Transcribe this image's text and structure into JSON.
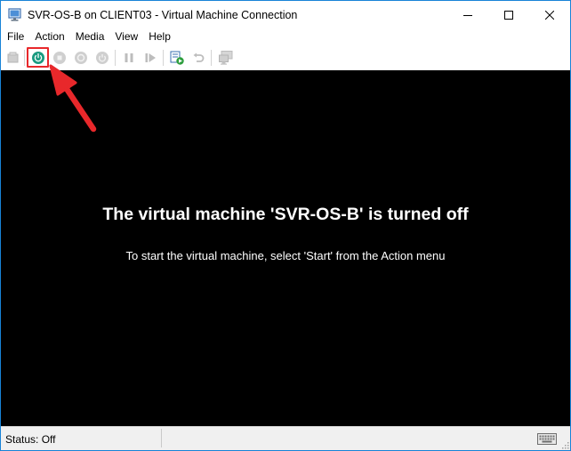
{
  "window": {
    "title": "SVR-OS-B on CLIENT03 - Virtual Machine Connection",
    "app_icon": "vm-connection-icon",
    "controls": [
      "minimize-icon",
      "maximize-icon",
      "close-icon"
    ]
  },
  "menu": {
    "items": [
      {
        "label": "File"
      },
      {
        "label": "Action"
      },
      {
        "label": "Media"
      },
      {
        "label": "View"
      },
      {
        "label": "Help"
      }
    ]
  },
  "toolbar": {
    "buttons": [
      {
        "icon": "ctrl-alt-del-icon",
        "enabled": false
      },
      {
        "icon": "start-icon",
        "enabled": true,
        "highlighted": true
      },
      {
        "icon": "turn-off-icon",
        "enabled": false
      },
      {
        "icon": "shut-down-icon",
        "enabled": false
      },
      {
        "icon": "save-icon",
        "enabled": false
      },
      {
        "icon": "pause-icon",
        "enabled": false
      },
      {
        "icon": "resume-icon",
        "enabled": false
      },
      {
        "icon": "checkpoint-icon",
        "enabled": true
      },
      {
        "icon": "revert-icon",
        "enabled": false
      },
      {
        "icon": "enhanced-session-icon",
        "enabled": false
      }
    ],
    "accent_color": "#1a9a80",
    "highlight_color": "#e8282b"
  },
  "screen": {
    "headline": "The virtual machine 'SVR-OS-B' is turned off",
    "instruction": "To start the virtual machine, select 'Start' from the Action menu",
    "background": "#000000"
  },
  "status": {
    "text": "Status: Off",
    "keyboard_icon": "keyboard-icon"
  }
}
